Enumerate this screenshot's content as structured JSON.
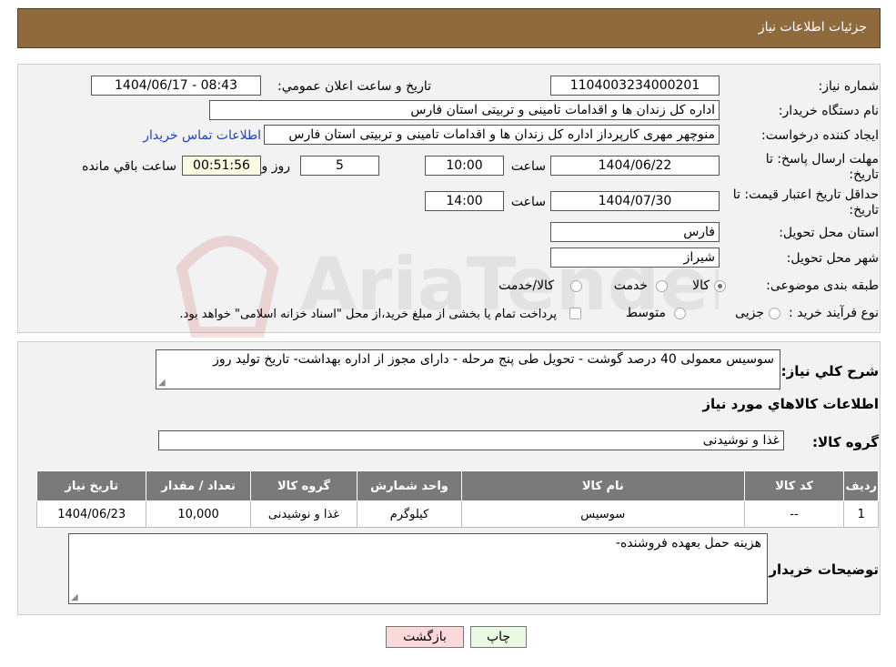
{
  "header": {
    "title": "جزئیات اطلاعات نیاز"
  },
  "form": {
    "need_number_label": "شماره نیاز:",
    "need_number": "1104003234000201",
    "announce_label": "تاریخ و ساعت اعلان عمومي:",
    "announce_value": "1404/06/17 - 08:43",
    "buyer_label": "نام دستگاه خریدار:",
    "buyer_value": "اداره کل زندان ها و اقدامات تامینی و تربیتی استان فارس",
    "creator_label": "ایجاد کننده درخواست:",
    "creator_value": "منوچهر  مهری  کارپرداز اداره کل زندان ها و اقدامات تامینی و تربیتی استان فارس",
    "contact_link": "اطلاعات تماس خریدار",
    "deadline_label_1": "مهلت ارسال پاسخ: تا",
    "deadline_label_2": "تاریخ:",
    "deadline_date": "1404/06/22",
    "time_label": "ساعت",
    "deadline_time": "10:00",
    "days_value": "5",
    "days_label": "روز و",
    "remaining_time": "00:51:56",
    "remaining_label": "ساعت باقي مانده",
    "validity_label_1": "حداقل تاریخ اعتبار قیمت: تا",
    "validity_label_2": "تاریخ:",
    "validity_date": "1404/07/30",
    "validity_time": "14:00",
    "province_label": "استان محل تحویل:",
    "province_value": "فارس",
    "city_label": "شهر محل تحویل:",
    "city_value": "شیراز",
    "category_label": "طبقه بندی موضوعی:",
    "category_options": [
      "کالا",
      "خدمت",
      "کالا/خدمت"
    ],
    "process_label": "نوع فرآیند خرید :",
    "process_options": [
      "جزیی",
      "متوسط"
    ],
    "process_note": "پرداخت تمام یا بخشی از مبلغ خرید،از محل \"اسناد خزانه اسلامی\" خواهد بود."
  },
  "details": {
    "summary_label": "شرح کلي نیاز:",
    "summary_value": "سوسیس معمولی 40 درصد گوشت - تحویل طی پنج مرحله - دارای مجوز از اداره بهداشت- تاریخ تولید روز",
    "goods_info_title": "اطلاعات کالاهاي مورد نیاز",
    "group_label": "گروه کالا:",
    "group_value": "غذا و نوشیدنی",
    "table": {
      "headers": [
        "ردیف",
        "کد کالا",
        "نام کالا",
        "واحد شمارش",
        "گروه کالا",
        "تعداد / مقدار",
        "تاریخ نیاز"
      ],
      "rows": [
        [
          "1",
          "--",
          "سوسیس",
          "کیلوگرم",
          "غذا و نوشیدنی",
          "10,000",
          "1404/06/23"
        ]
      ]
    },
    "buyer_notes_label": "توضیحات خریدار:",
    "buyer_notes_value": "هزینه حمل بعهده فروشنده-"
  },
  "buttons": {
    "print": "چاپ",
    "back": "بازگشت"
  },
  "watermark": {
    "text": "AriaTender.neT"
  },
  "colors": {
    "header_bg": "#8f6a3c",
    "table_header_bg": "#7a7a7a",
    "back_button_bg": "#fbd9d9"
  }
}
